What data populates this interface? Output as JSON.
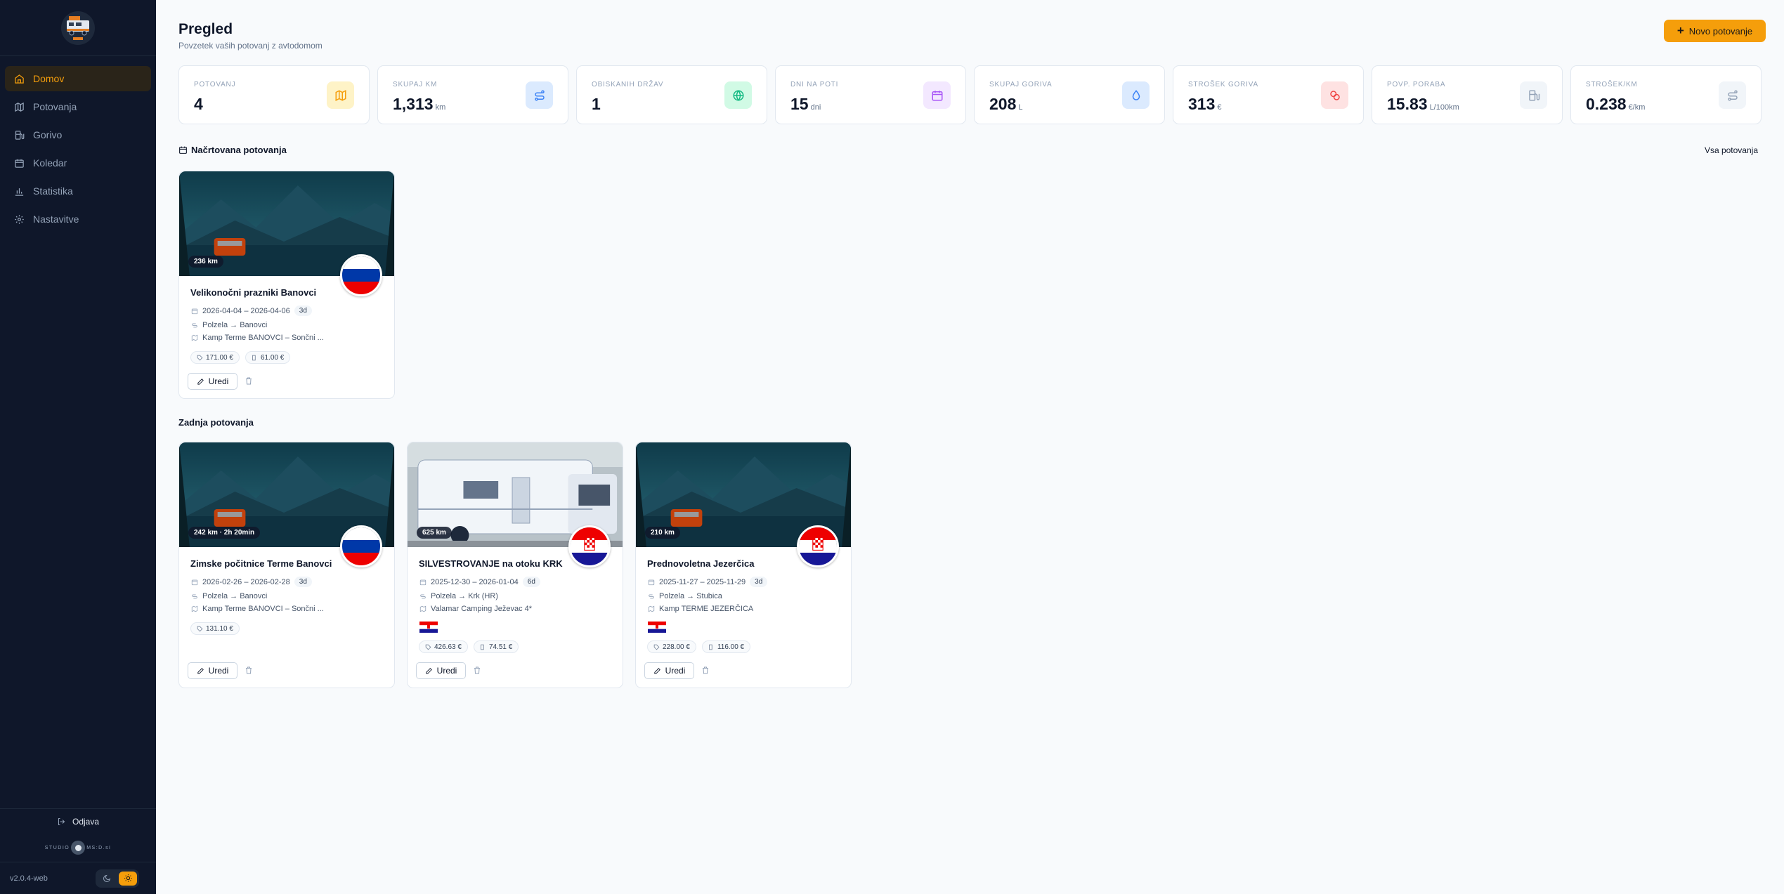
{
  "sidebar": {
    "items": [
      {
        "label": "Domov",
        "icon": "home-icon",
        "active": true
      },
      {
        "label": "Potovanja",
        "icon": "map-icon"
      },
      {
        "label": "Gorivo",
        "icon": "fuel-icon"
      },
      {
        "label": "Koledar",
        "icon": "calendar-icon"
      },
      {
        "label": "Statistika",
        "icon": "bar-chart-icon"
      },
      {
        "label": "Nastavitve",
        "icon": "gear-icon"
      }
    ],
    "logout": "Odjava",
    "studio_left": "STUDIO",
    "studio_right": "MS:D.si",
    "version": "v2.0.4-web"
  },
  "header": {
    "title": "Pregled",
    "subtitle": "Povzetek vaših potovanj z avtodomom",
    "new_button": "Novo potovanje"
  },
  "stats": [
    {
      "label": "POTOVANJ",
      "value": "4",
      "unit": "",
      "icon": "map-icon",
      "color": "#f59e0b"
    },
    {
      "label": "SKUPAJ KM",
      "value": "1,313",
      "unit": "km",
      "icon": "route-icon",
      "color": "#3b82f6"
    },
    {
      "label": "OBISKANIH DRŽAV",
      "value": "1",
      "unit": "",
      "icon": "globe-icon",
      "color": "#10b981"
    },
    {
      "label": "DNI NA POTI",
      "value": "15",
      "unit": "dni",
      "icon": "calendar-icon",
      "color": "#a855f7"
    },
    {
      "label": "SKUPAJ GORIVA",
      "value": "208",
      "unit": "L",
      "icon": "droplet-icon",
      "color": "#3b82f6"
    },
    {
      "label": "STROŠEK GORIVA",
      "value": "313",
      "unit": "€",
      "icon": "coins-icon",
      "color": "#ef4444"
    },
    {
      "label": "POVP. PORABA",
      "value": "15.83",
      "unit": "L/100km",
      "icon": "fuel-icon",
      "color": "#94a3b8"
    },
    {
      "label": "STROŠEK/KM",
      "value": "0.238",
      "unit": "€/km",
      "icon": "route-icon",
      "color": "#94a3b8"
    }
  ],
  "planned": {
    "title": "Načrtovana potovanja",
    "all_link": "Vsa potovanja",
    "trips": [
      {
        "title": "Velikonočni prazniki Banovci",
        "distance": "236 km",
        "dates": "2026-04-04 – 2026-04-06",
        "days": "3d",
        "route": "Polzela → Banovci",
        "camp": "Kamp Terme BANOVCI – Sončni ...",
        "chips": [
          "171.00 €",
          "61.00 €"
        ],
        "flag": "si",
        "edit": "Uredi"
      }
    ]
  },
  "recent": {
    "title": "Zadnja potovanja",
    "trips": [
      {
        "title": "Zimske počitnice Terme Banovci",
        "distance": "242 km · 2h 20min",
        "dates": "2026-02-26 – 2026-02-28",
        "days": "3d",
        "route": "Polzela → Banovci",
        "camp": "Kamp Terme BANOVCI – Sončni ...",
        "chips": [
          "131.10 €"
        ],
        "flag": "si",
        "edit": "Uredi"
      },
      {
        "title": "SILVESTROVANJE na otoku KRK",
        "distance": "625 km",
        "dates": "2025-12-30 – 2026-01-04",
        "days": "6d",
        "route": "Polzela → Krk (HR)",
        "camp": "Valamar Camping Ježevac 4*",
        "chips": [
          "426.63 €",
          "74.51 €"
        ],
        "flag": "hr",
        "edit": "Uredi"
      },
      {
        "title": "Prednovoletna Jezerčica",
        "distance": "210 km",
        "dates": "2025-11-27 – 2025-11-29",
        "days": "3d",
        "route": "Polzela → Stubica",
        "camp": "Kamp TERME JEZERČICA",
        "chips": [
          "228.00 €",
          "116.00 €"
        ],
        "flag": "hr",
        "edit": "Uredi"
      }
    ]
  }
}
